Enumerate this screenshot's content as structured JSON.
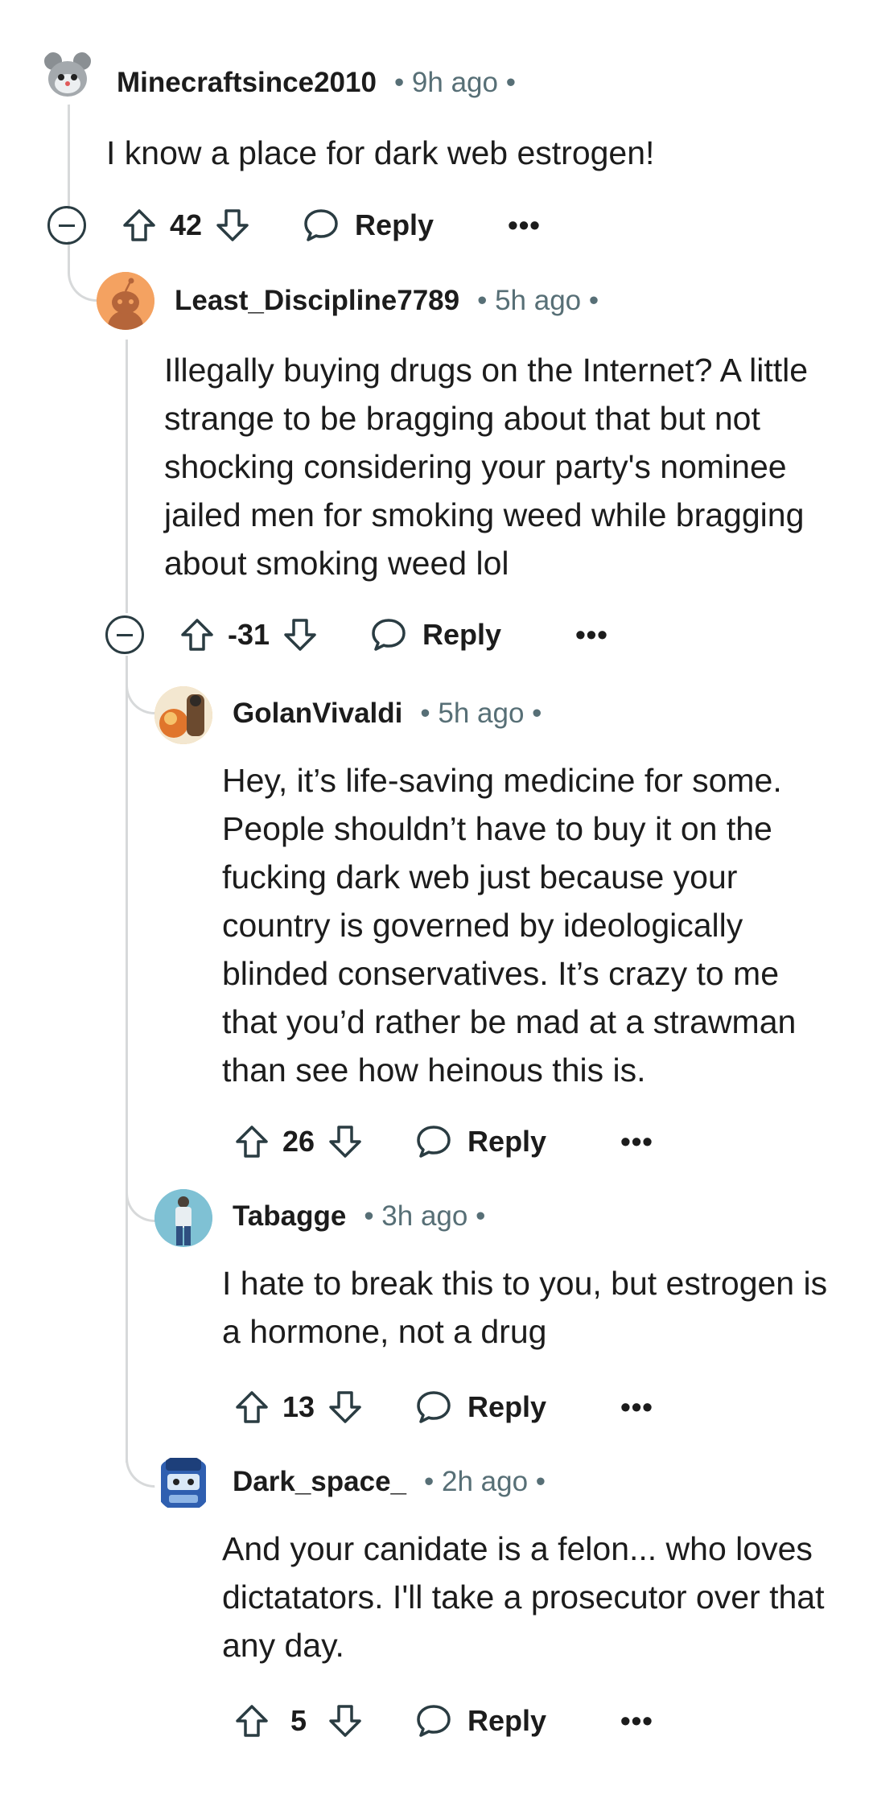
{
  "comments": [
    {
      "username": "Minecraftsince2010",
      "time": "• 9h ago •",
      "text": "I know a place for dark web estrogen!",
      "score": "42",
      "reply_label": "Reply",
      "more": "•••",
      "avatar_color": "#e9eef0"
    },
    {
      "username": "Least_Discipline7789",
      "time": "• 5h ago •",
      "text": "Illegally buying drugs on the Internet? A little strange to be bragging about that but not shocking considering your party's nominee jailed men for smoking weed while bragging about smoking weed lol",
      "score": "-31",
      "reply_label": "Reply",
      "more": "•••",
      "avatar_color": "#f4a261"
    },
    {
      "username": "GolanVivaldi",
      "time": "• 5h ago •",
      "text": "Hey, it’s life-saving medicine for some. People shouldn’t have to buy it on the fucking dark web just because your country is governed by ideologically blinded conservatives. It’s crazy to me that you’d rather be mad at a strawman than see how heinous this is.",
      "score": "26",
      "reply_label": "Reply",
      "more": "•••",
      "avatar_color": "#f6c26b"
    },
    {
      "username": "Tabagge",
      "time": "• 3h ago •",
      "text": "I hate to break this to you, but estrogen is a hormone, not a drug",
      "score": "13",
      "reply_label": "Reply",
      "more": "•••",
      "avatar_color": "#7fc1d4"
    },
    {
      "username": "Dark_space_",
      "time": "• 2h ago •",
      "text": "And your canidate is a felon... who loves dictatators. I'll take a prosecutor over that any day.",
      "score": "5",
      "reply_label": "Reply",
      "more": "•••",
      "avatar_color": "#2f5fb0"
    }
  ]
}
